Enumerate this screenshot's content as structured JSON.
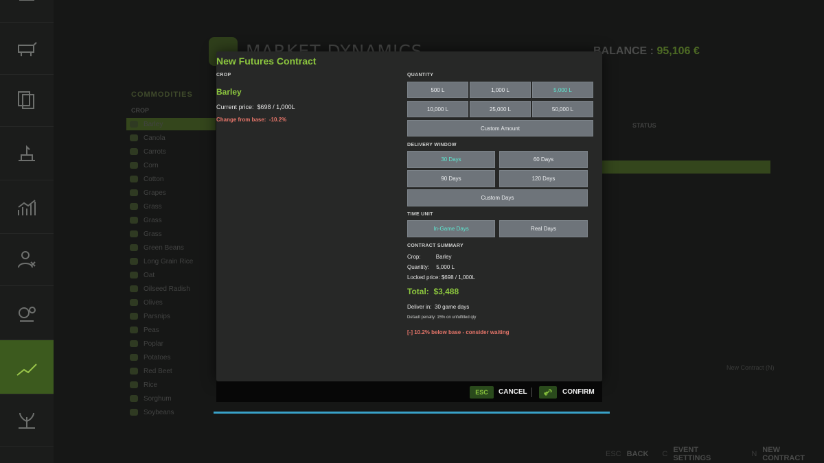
{
  "sidebar": {
    "items": [
      {
        "icon": "tractor-icon"
      },
      {
        "icon": "cow-icon"
      },
      {
        "icon": "documents-icon"
      },
      {
        "icon": "production-icon"
      },
      {
        "icon": "stats-chart-icon"
      },
      {
        "icon": "worker-icon"
      },
      {
        "icon": "gears-icon"
      },
      {
        "icon": "market-trend-icon",
        "active": true
      },
      {
        "icon": "plant-icon"
      }
    ]
  },
  "background": {
    "title": "MARKET DYNAMICS",
    "balance_label": "BALANCE :",
    "balance_value": "95,106 €",
    "commodities_header": "COMMODITIES",
    "crop_header": "CROP",
    "status_header": "STATUS",
    "new_contract_hint": "New Contract (N)",
    "crops": [
      "Barley",
      "Canola",
      "Carrots",
      "Corn",
      "Cotton",
      "Grapes",
      "Grass",
      "Grass",
      "Grass",
      "Green Beans",
      "Long Grain Rice",
      "Oat",
      "Oilseed Radish",
      "Olives",
      "Parsnips",
      "Peas",
      "Poplar",
      "Potatoes",
      "Red Beet",
      "Rice",
      "Sorghum",
      "Soybeans"
    ],
    "bottom_bar": [
      {
        "key": "ESC",
        "label": "BACK"
      },
      {
        "key": "C",
        "label": "EVENT SETTINGS"
      },
      {
        "key": "N",
        "label": "NEW CONTRACT"
      }
    ]
  },
  "modal": {
    "title": "New Futures Contract",
    "crop_label": "CROP",
    "crop_name": "Barley",
    "current_price_label": "Current price:",
    "current_price": "$698 / 1,000L",
    "change_label": "Change from base:",
    "change_value": "-10.2%",
    "quantity_label": "QUANTITY",
    "quantity_options": [
      "500 L",
      "1,000 L",
      "5,000 L",
      "10,000 L",
      "25,000 L",
      "50,000 L"
    ],
    "quantity_selected": "5,000 L",
    "custom_amount": "Custom Amount",
    "delivery_label": "DELIVERY WINDOW",
    "delivery_options": [
      "30 Days",
      "60 Days",
      "90 Days",
      "120 Days"
    ],
    "delivery_selected": "30 Days",
    "custom_days": "Custom Days",
    "time_unit_label": "TIME UNIT",
    "time_unit_options": [
      "In-Game Days",
      "Real Days"
    ],
    "time_unit_selected": "In-Game Days",
    "summary_label": "CONTRACT SUMMARY",
    "summary": {
      "crop_label": "Crop:",
      "crop_value": "Barley",
      "quantity_label": "Quantity:",
      "quantity_value": "5,000 L",
      "locked_label": "Locked price:",
      "locked_value": "$698 / 1,000L"
    },
    "total_label": "Total:",
    "total_value": "$3,488",
    "deliver_label": "Deliver in:",
    "deliver_value": "30 game days",
    "penalty": "Default penalty: 15% on unfulfilled qty",
    "warning": "[-] 10.2% below base - consider waiting",
    "footer": {
      "cancel_key": "ESC",
      "cancel_label": "CANCEL",
      "confirm_label": "CONFIRM"
    }
  }
}
